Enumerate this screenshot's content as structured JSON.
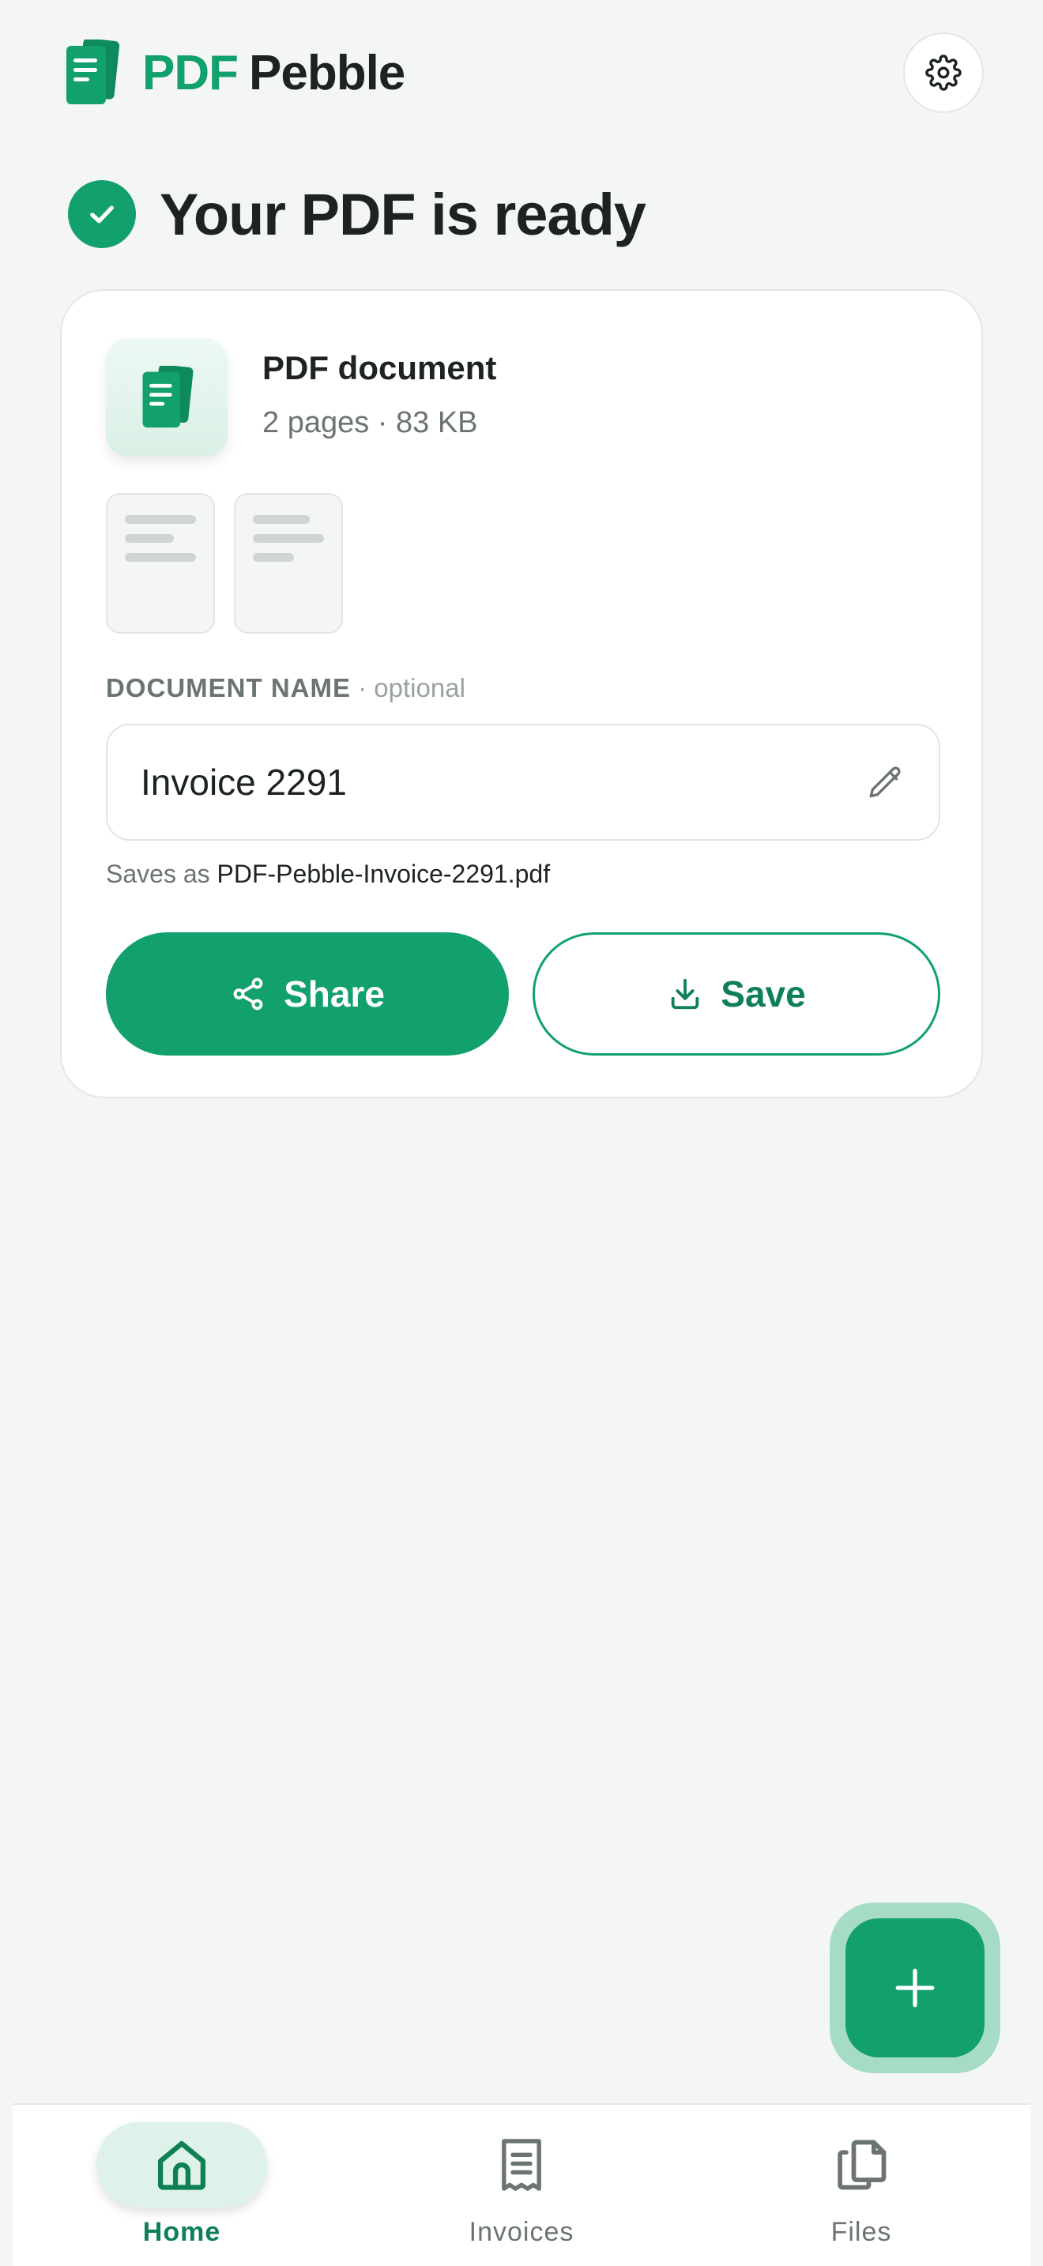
{
  "header": {
    "brand_part1": "PDF",
    "brand_part2": "Pebble"
  },
  "status": {
    "title": "Your PDF is ready"
  },
  "document": {
    "type": "PDF document",
    "meta": "2 pages · 83 KB",
    "page_count": 2
  },
  "name_field": {
    "label": "DOCUMENT NAME",
    "optional": " · optional",
    "value": "Invoice 2291",
    "saves_as_prefix": "Saves as ",
    "saves_as_filename": "PDF-Pebble-Invoice-2291.pdf"
  },
  "actions": {
    "share_label": "Share",
    "save_label": "Save"
  },
  "bottom_nav": {
    "items": [
      {
        "label": "Home",
        "icon": "home-icon",
        "active": true
      },
      {
        "label": "Invoices",
        "icon": "receipt-icon",
        "active": false
      },
      {
        "label": "Files",
        "icon": "files-icon",
        "active": false
      }
    ]
  },
  "colors": {
    "accent": "#12a06c",
    "accent_dark": "#0f7f56",
    "background": "#f4f6f5",
    "text": "#1c2321",
    "muted": "#6b7470"
  }
}
